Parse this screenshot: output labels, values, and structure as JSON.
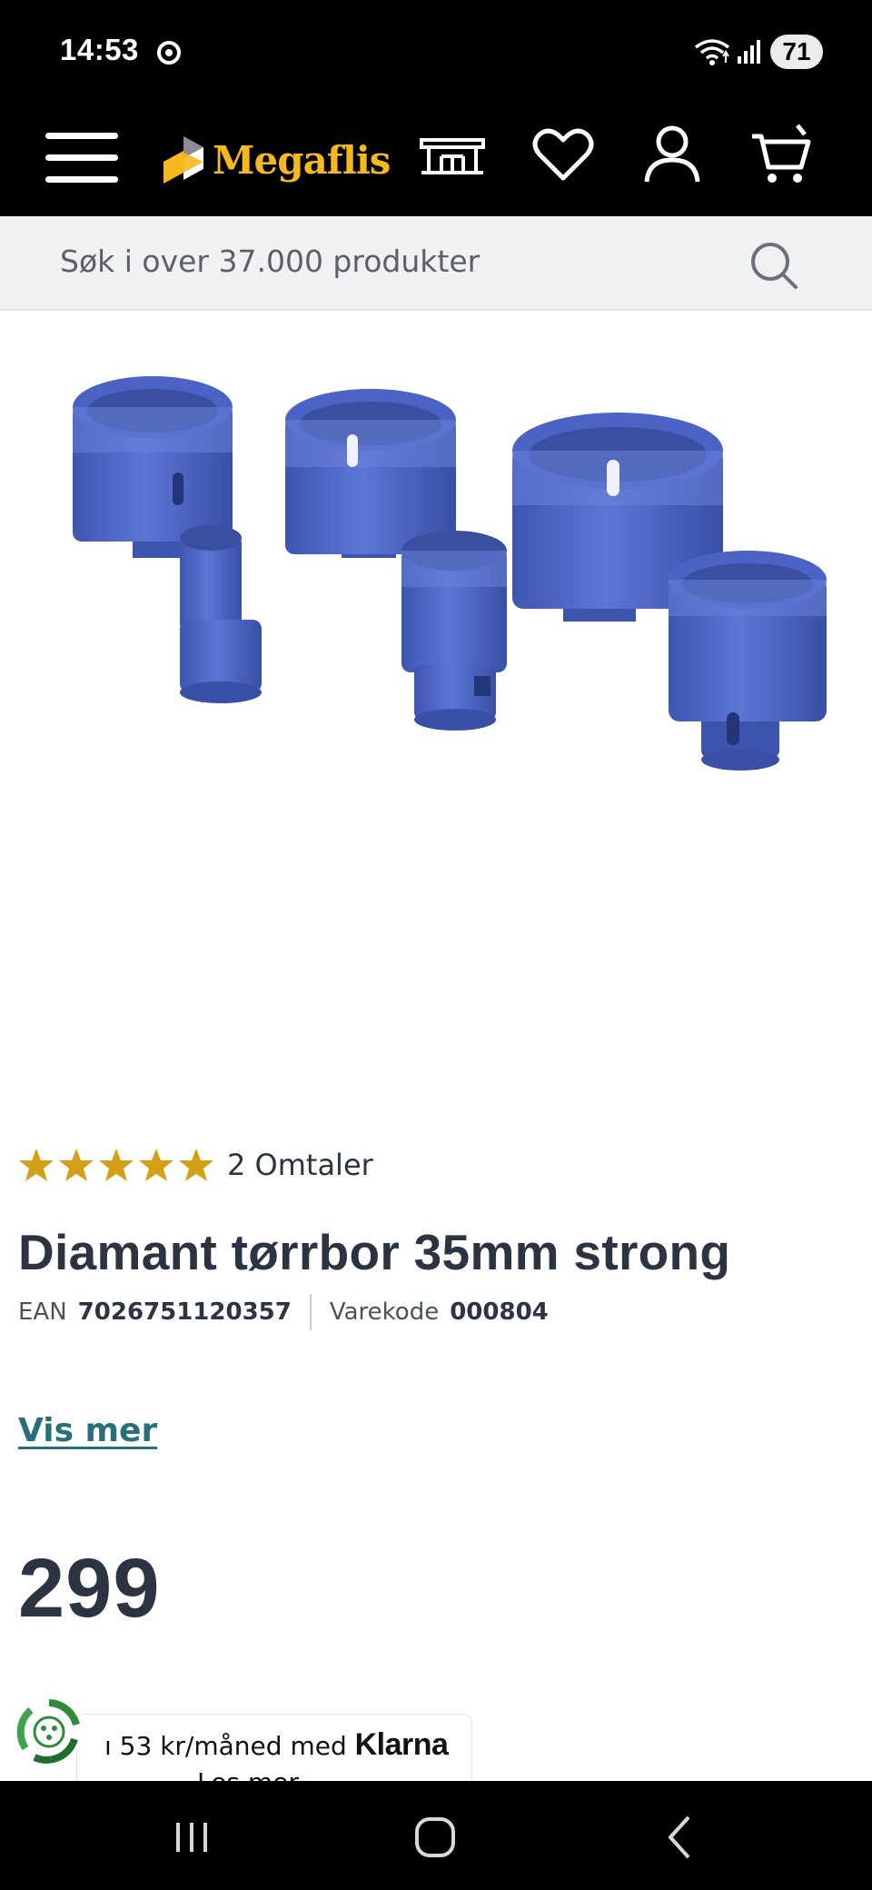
{
  "status_bar": {
    "time": "14:53",
    "battery": "71",
    "icons": [
      "app-notification-icon",
      "wifi-icon",
      "signal-icon"
    ]
  },
  "header": {
    "logo_text": "Megaflis",
    "icons": [
      "menu-icon",
      "showroom-icon",
      "heart-icon",
      "user-icon",
      "cart-icon"
    ],
    "brand_color": "#f6b81d"
  },
  "search": {
    "placeholder": "Søk i over 37.000 produkter"
  },
  "product": {
    "image_icon": "diamond-core-drill-set-image",
    "rating": 5,
    "rating_max": 5,
    "reviews_label": "2 Omtaler",
    "title": "Diamant tørrbor 35mm strong",
    "ean_label": "EAN",
    "ean": "7026751120357",
    "sku_label": "Varekode",
    "sku": "000804",
    "show_more": "Vis mer",
    "price": "299",
    "star_color": "#d4a017",
    "link_color": "#27707a"
  },
  "klarna": {
    "text": "ı 53 kr/måned med ",
    "brand": "Klarna",
    "read_more": "Les mer"
  },
  "nav_bar": {
    "icons": [
      "recent-apps-icon",
      "home-icon",
      "back-icon"
    ]
  }
}
